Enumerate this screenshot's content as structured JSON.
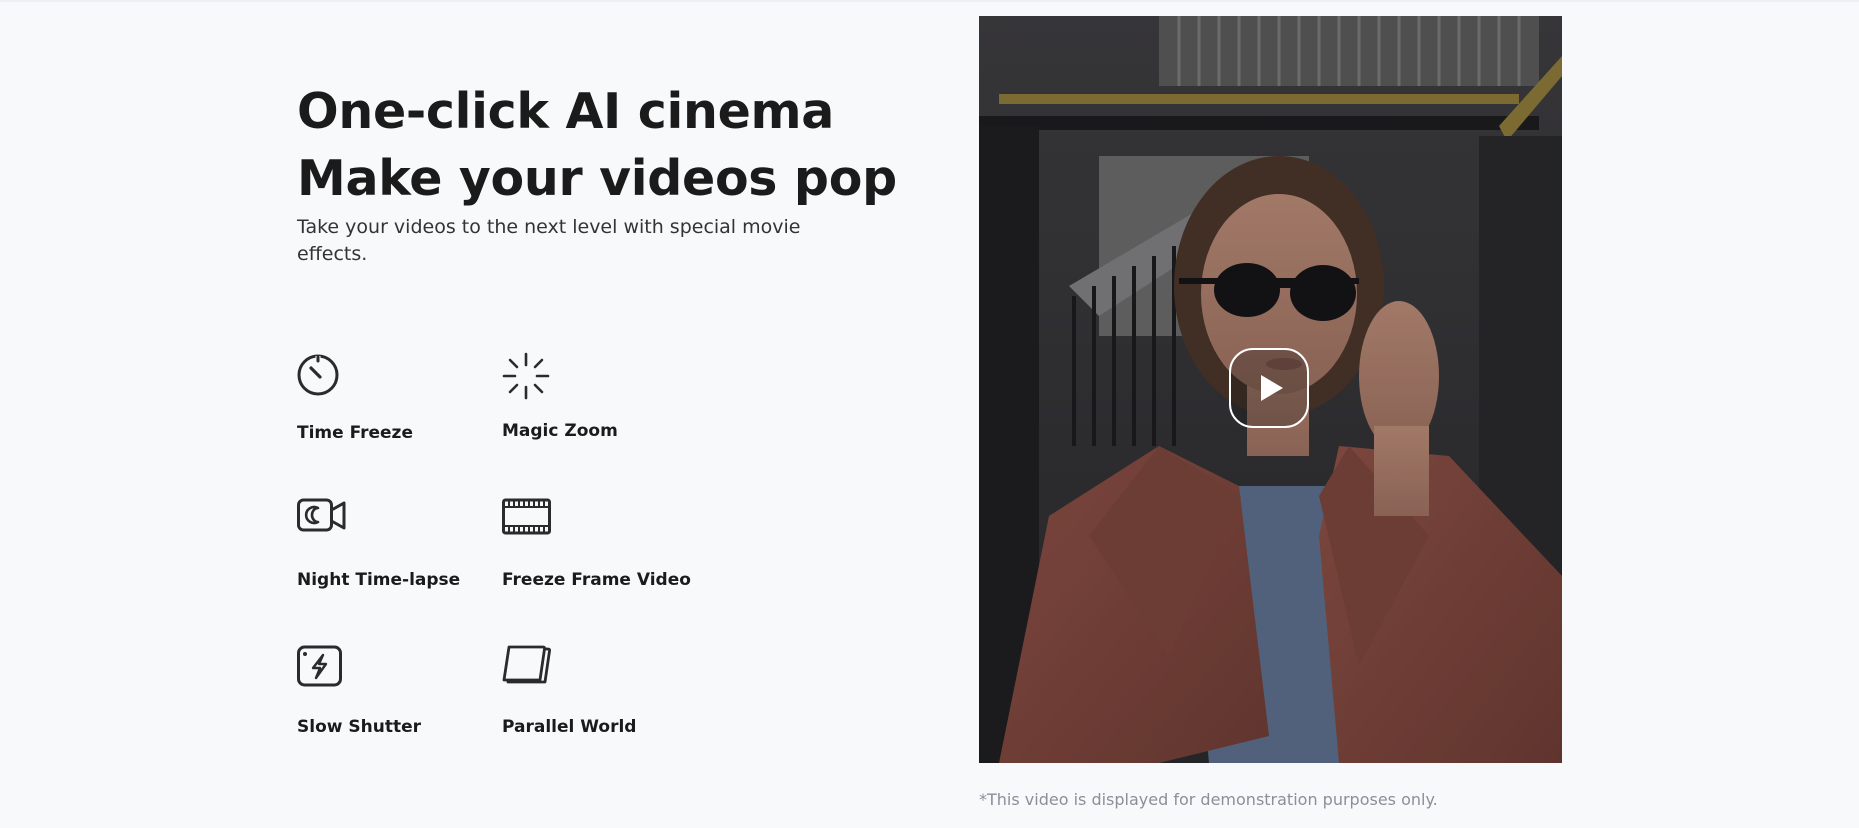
{
  "hero": {
    "headline_line1": "One-click AI cinema",
    "headline_line2": "Make your videos pop",
    "subtitle": "Take your videos to the next level with special movie effects."
  },
  "features": [
    {
      "label": "Time Freeze",
      "icon": "stopwatch-icon"
    },
    {
      "label": "Magic Zoom",
      "icon": "burst-zoom-icon"
    },
    {
      "label": "Night Time-lapse",
      "icon": "moon-camera-icon"
    },
    {
      "label": "Freeze Frame Video",
      "icon": "film-strip-icon"
    },
    {
      "label": "Slow Shutter",
      "icon": "lightning-shutter-icon"
    },
    {
      "label": "Parallel World",
      "icon": "stacked-layers-icon"
    }
  ],
  "video": {
    "thumbnail": "woman-in-sunglasses-and-coat-in-alley",
    "play_icon": "play-icon"
  },
  "disclaimer": "*This video is displayed for demonstration purposes only.",
  "colors": {
    "background": "#f8f9fb",
    "text": "#1b1b1b",
    "muted_text": "#8a8f98"
  }
}
